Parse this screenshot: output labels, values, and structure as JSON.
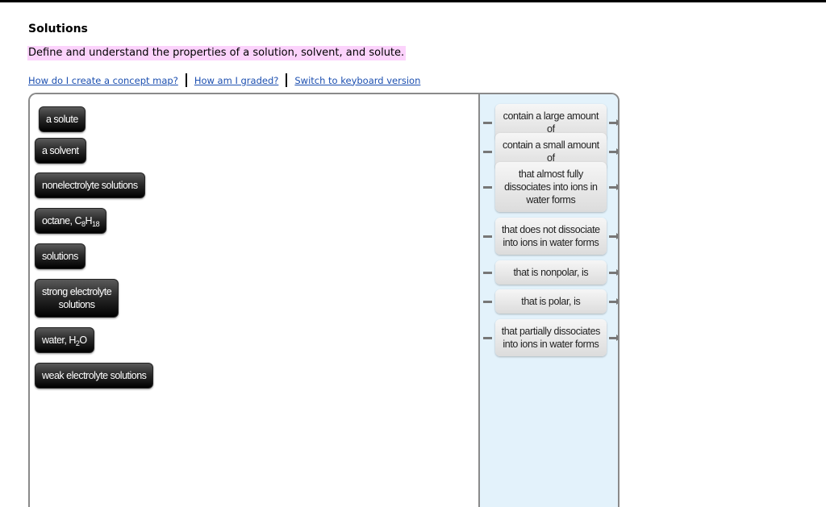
{
  "header": {
    "title": "Solutions",
    "objective": "Define and understand the properties of a solution, solvent, and solute.",
    "links": [
      {
        "label": "How do I create a concept map?"
      },
      {
        "label": "How am I graded?"
      },
      {
        "label": "Switch to keyboard version"
      }
    ]
  },
  "concepts": [
    {
      "label": "a solute"
    },
    {
      "label": "a solvent"
    },
    {
      "label": "nonelectrolyte solutions"
    },
    {
      "label_pre": "octane, C",
      "sub1": "8",
      "mid": "H",
      "sub2": "18"
    },
    {
      "label": "solutions"
    },
    {
      "label_line1": "strong electrolyte",
      "label_line2": "solutions"
    },
    {
      "label_pre": "water, H",
      "sub1": "2",
      "mid": "O"
    },
    {
      "label": "weak electrolyte solutions"
    }
  ],
  "linking_phrases": [
    {
      "label": "contain a large amount of"
    },
    {
      "label": "contain a small amount of"
    },
    {
      "label_line1": "that almost fully",
      "label_line2": "dissociates into ions in",
      "label_line3": "water forms"
    },
    {
      "label_line1": "that does not dissociate",
      "label_line2": "into ions in water forms"
    },
    {
      "label": "that is nonpolar, is"
    },
    {
      "label": "that is polar, is"
    },
    {
      "label_line1": "that partially dissociates",
      "label_line2": "into ions in water forms"
    }
  ],
  "colors": {
    "objective_highlight": "#fcd3fc",
    "link_color": "#1c4fb0",
    "word_bank_bg": "#e3f2fb"
  }
}
